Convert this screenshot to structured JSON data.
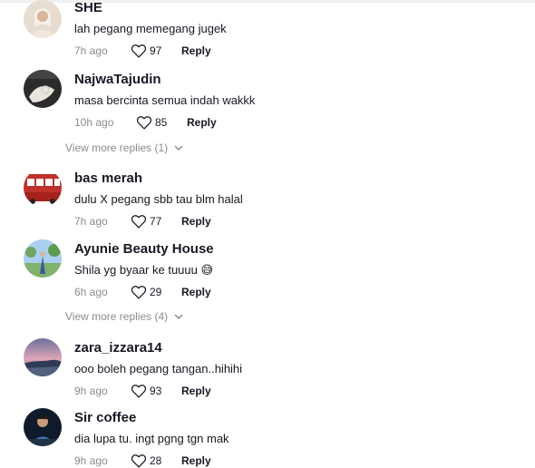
{
  "comments": [
    {
      "username": "SHE",
      "text": "lah pegang memegang jugek",
      "time": "7h ago",
      "likes": "97",
      "reply": "Reply",
      "avatar_color": "#d8cfc0"
    },
    {
      "username": "NajwaTajudin",
      "text": "masa bercinta semua indah wakkk",
      "time": "10h ago",
      "likes": "85",
      "reply": "Reply",
      "avatar_color": "#3a3a3a"
    },
    {
      "username": "bas merah",
      "text": "dulu X pegang sbb tau blm halal",
      "time": "7h ago",
      "likes": "77",
      "reply": "Reply",
      "avatar_color": "#c0302a"
    },
    {
      "username": "Ayunie Beauty House",
      "text": "Shila yg byaar ke tuuuu",
      "emoji": "😅",
      "time": "6h ago",
      "likes": "29",
      "reply": "Reply",
      "avatar_color": "#9fc6e8"
    },
    {
      "username": "zara_izzara14",
      "text": "ooo boleh pegang tangan..hihihi",
      "time": "9h ago",
      "likes": "93",
      "reply": "Reply",
      "avatar_color": "#4a4a6a"
    },
    {
      "username": "Sir coffee",
      "text": "dia lupa tu. ingt pgng tgn mak",
      "time": "9h ago",
      "likes": "28",
      "reply": "Reply",
      "avatar_color": "#5b87b8"
    }
  ],
  "view_more": [
    {
      "label": "View more replies (1)"
    },
    {
      "label": "View more replies (4)"
    }
  ]
}
